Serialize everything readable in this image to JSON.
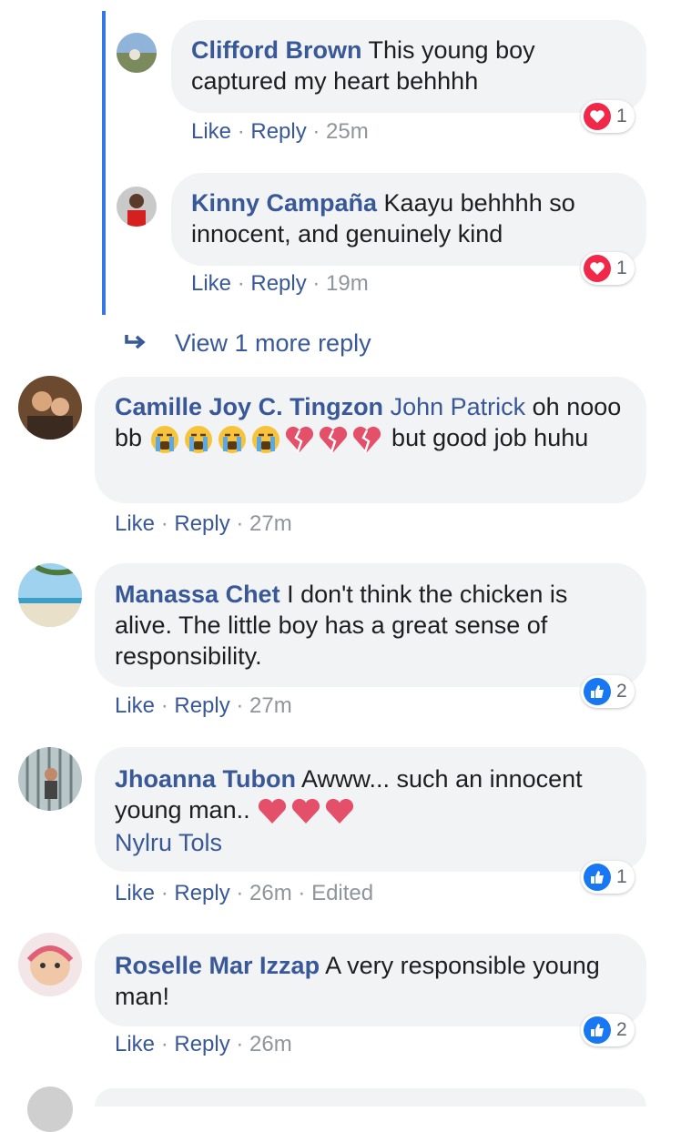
{
  "replies": [
    {
      "name": "Clifford Brown",
      "text": " This young boy captured my heart behhhh",
      "like": "Like",
      "reply": "Reply",
      "time": "25m",
      "reaction_count": "1"
    },
    {
      "name": "Kinny Campaña",
      "text": " Kaayu behhhh so innocent, and genuinely kind",
      "like": "Like",
      "reply": "Reply",
      "time": "19m",
      "reaction_count": "1"
    }
  ],
  "view_more": "View 1 more reply",
  "separator": " · ",
  "comments": [
    {
      "name": "Camille Joy C. Tingzon",
      "mention": "John Patrick",
      "text_a": " oh nooo bb ",
      "text_b": " but good job huhu",
      "like": "Like",
      "reply": "Reply",
      "time": "27m"
    },
    {
      "name": "Manassa Chet",
      "text": " I don't think the chicken is alive. The little boy has a great sense of responsibility.",
      "like": "Like",
      "reply": "Reply",
      "time": "27m",
      "reaction_count": "2"
    },
    {
      "name": "Jhoanna Tubon",
      "text": " Awww... such an innocent young man.. ",
      "mention": "Nylru Tols",
      "like": "Like",
      "reply": "Reply",
      "time": "26m",
      "edited": "Edited",
      "reaction_count": "1"
    },
    {
      "name": "Roselle Mar Izzap",
      "text": " A very responsible young man!",
      "like": "Like",
      "reply": "Reply",
      "time": "26m",
      "reaction_count": "2"
    }
  ],
  "colors": {
    "link": "#385898",
    "bubble": "#f2f3f5",
    "thread_line": "#3578e5",
    "love": "#f0284a",
    "like": "#1877f2",
    "meta": "#90949c"
  }
}
